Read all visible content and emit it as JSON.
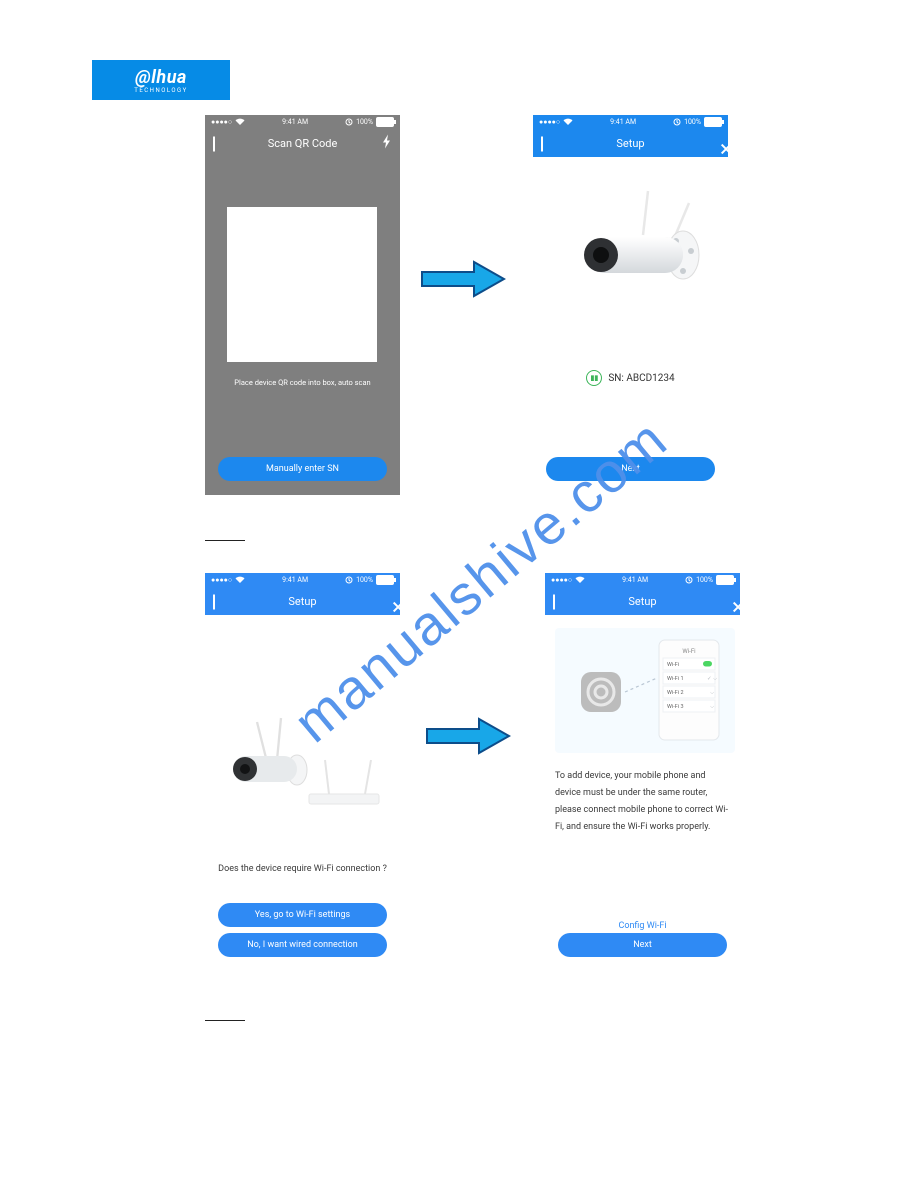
{
  "logo": {
    "brand": "@lhua",
    "tagline": "TECHNOLOGY"
  },
  "statusbar": {
    "signal": "●●●●○",
    "wifi_icon": "wifi-icon",
    "time": "9:41 AM",
    "alarm_icon": "alarm-icon",
    "battery_pct": "100%"
  },
  "screen1": {
    "title": "Scan QR Code",
    "hint": "Place device QR code into box, auto scan",
    "button": "Manually enter SN"
  },
  "screen2": {
    "title": "Setup",
    "sn_label": "SN: ABCD1234",
    "button": "Next"
  },
  "screen3": {
    "title": "Setup",
    "question": "Does the device require Wi-Fi connection ?",
    "btn_yes": "Yes, go to Wi-Fi settings",
    "btn_no": "No, I want wired connection"
  },
  "screen4": {
    "title": "Setup",
    "wifi_panel": {
      "heading": "Wi-Fi",
      "rows": [
        "Wi-Fi",
        "Wi-Fi 1",
        "Wi-Fi 2",
        "Wi-Fi 3"
      ]
    },
    "description": "To add device, your mobile phone and device must be under the same router, please connect mobile phone to correct Wi-Fi, and ensure the Wi-Fi works properly.",
    "link": "Config Wi-Fi",
    "button": "Next"
  },
  "watermark": "manualshive.com"
}
